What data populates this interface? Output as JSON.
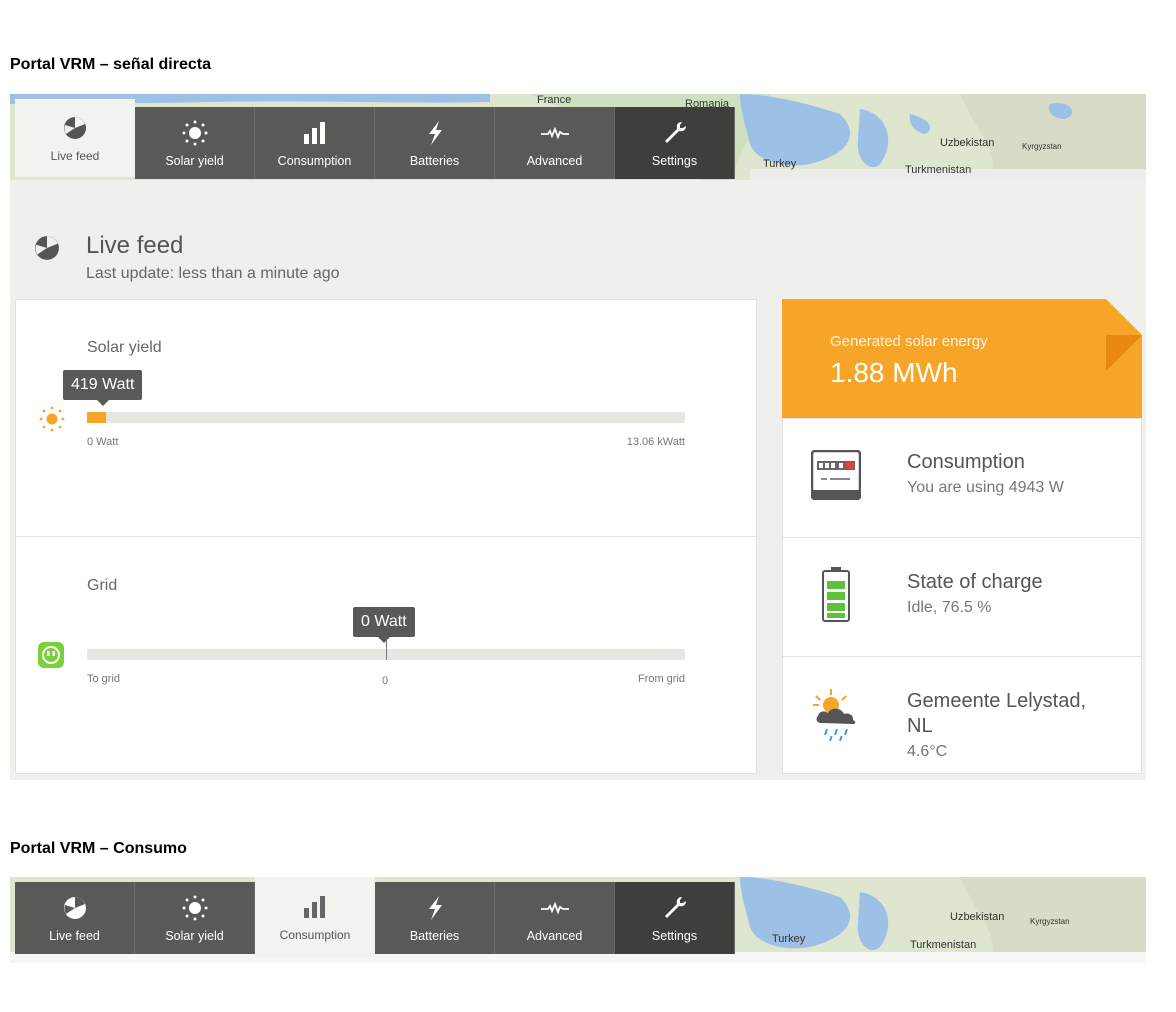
{
  "sections": [
    {
      "title": "Portal VRM – señal directa"
    },
    {
      "title": "Portal VRM – Consumo"
    }
  ],
  "map_labels": [
    "France",
    "Romania",
    "Turkey",
    "Uzbekistan",
    "Kyrgyzstan",
    "Turkmenistan"
  ],
  "tabs": [
    {
      "label": "Live feed",
      "icon": "live-feed-icon"
    },
    {
      "label": "Solar yield",
      "icon": "sun-icon"
    },
    {
      "label": "Consumption",
      "icon": "bar-chart-icon"
    },
    {
      "label": "Batteries",
      "icon": "lightning-icon"
    },
    {
      "label": "Advanced",
      "icon": "waveform-icon"
    },
    {
      "label": "Settings",
      "icon": "wrench-icon"
    }
  ],
  "live_feed": {
    "title": "Live feed",
    "last_update": "Last update: less than a minute ago"
  },
  "solar": {
    "title": "Solar yield",
    "tooltip": "419 Watt",
    "min_label": "0 Watt",
    "max_label": "13.06 kWatt",
    "fill_fraction": 0.032
  },
  "grid": {
    "title": "Grid",
    "tooltip": "0 Watt",
    "left_label": "To grid",
    "center_label": "0",
    "right_label": "From grid",
    "position_fraction": 0.5
  },
  "generated": {
    "label": "Generated solar energy",
    "value": "1.88 MWh"
  },
  "consumption": {
    "title": "Consumption",
    "sub": "You are using 4943 W"
  },
  "soc": {
    "title": "State of charge",
    "sub": "Idle, 76.5 %"
  },
  "weather": {
    "line1": "Gemeente Lelystad,",
    "line2": "NL",
    "temp": "4.6°C"
  },
  "colors": {
    "accent_orange": "#f7a529",
    "tab_dark": "#5a5955",
    "tab_settings": "#3f3e3b",
    "grid_green": "#7ccf3c",
    "battery_green": "#5cc23a"
  }
}
